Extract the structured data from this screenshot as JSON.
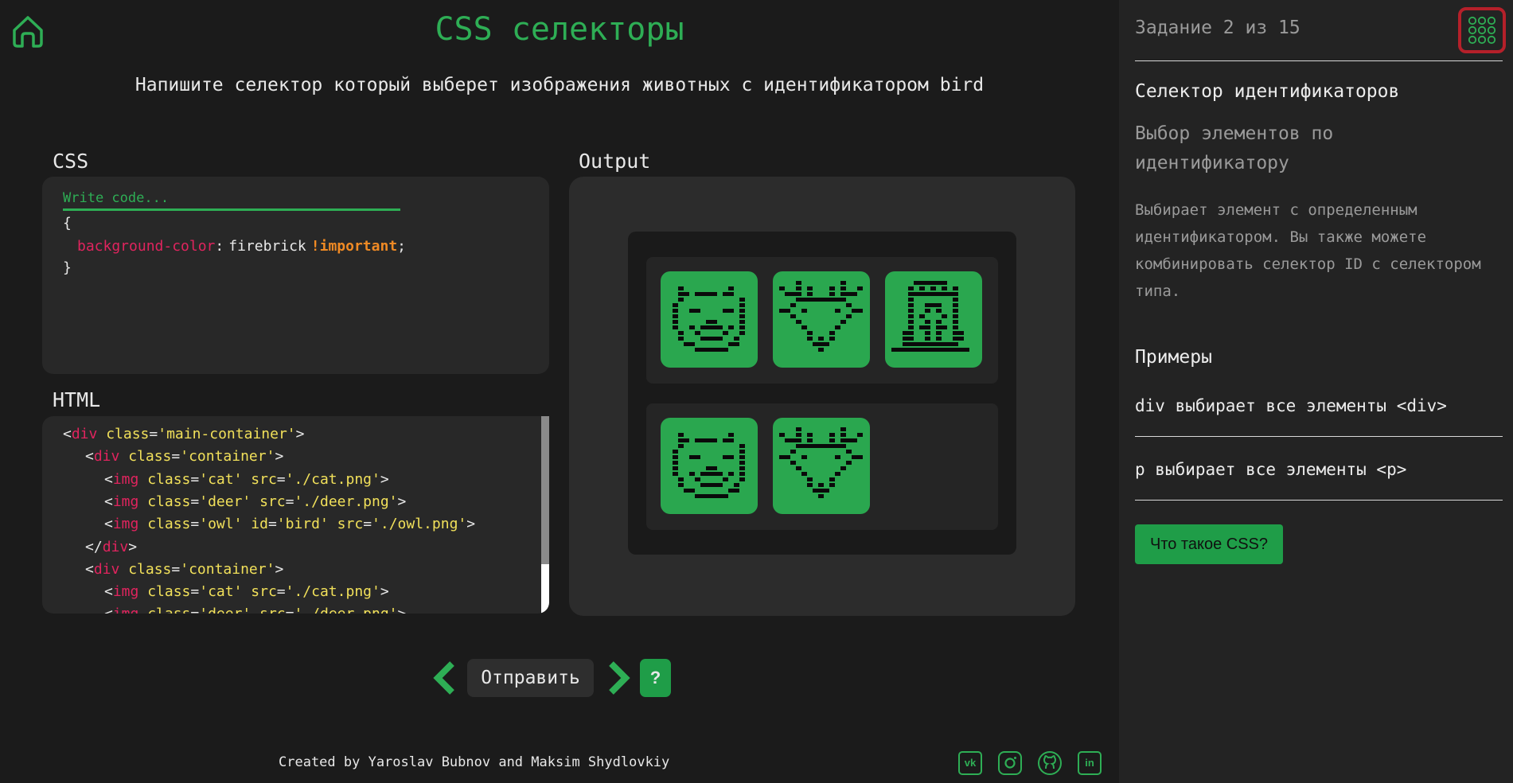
{
  "header": {
    "title": "CSS селекторы",
    "task": "Напишите селектор который выберет изображения животных с идентификатором bird"
  },
  "css_panel": {
    "label": "CSS",
    "placeholder": "Write code...",
    "open_brace": "{",
    "property": "background-color",
    "colon": ":",
    "value": "firebrick",
    "important": "!important",
    "semicolon": ";",
    "close_brace": "}"
  },
  "html_panel": {
    "label": "HTML",
    "lines": [
      {
        "indent": "",
        "open": "<",
        "tag": "div",
        "attrs": [
          {
            "name": "class",
            "value": "'main-container'"
          }
        ],
        "close": ">"
      },
      {
        "indent": "  ",
        "open": "<",
        "tag": "div",
        "attrs": [
          {
            "name": "class",
            "value": "'container'"
          }
        ],
        "close": ">"
      },
      {
        "indent": "    ",
        "open": "<",
        "tag": "img",
        "attrs": [
          {
            "name": "class",
            "value": "'cat'"
          },
          {
            "name": "src",
            "value": "'./cat.png'"
          }
        ],
        "close": ">"
      },
      {
        "indent": "    ",
        "open": "<",
        "tag": "img",
        "attrs": [
          {
            "name": "class",
            "value": "'deer'"
          },
          {
            "name": "src",
            "value": "'./deer.png'"
          }
        ],
        "close": ">"
      },
      {
        "indent": "    ",
        "open": "<",
        "tag": "img",
        "attrs": [
          {
            "name": "class",
            "value": "'owl'"
          },
          {
            "name": "id",
            "value": "'bird'"
          },
          {
            "name": "src",
            "value": "'./owl.png'"
          }
        ],
        "close": ">"
      },
      {
        "indent": "  ",
        "open": "</",
        "tag": "div",
        "attrs": [],
        "close": ">"
      },
      {
        "indent": "  ",
        "open": "<",
        "tag": "div",
        "attrs": [
          {
            "name": "class",
            "value": "'container'"
          }
        ],
        "close": ">"
      },
      {
        "indent": "    ",
        "open": "<",
        "tag": "img",
        "attrs": [
          {
            "name": "class",
            "value": "'cat'"
          },
          {
            "name": "src",
            "value": "'./cat.png'"
          }
        ],
        "close": ">"
      },
      {
        "indent": "    ",
        "open": "<",
        "tag": "img",
        "attrs": [
          {
            "name": "class",
            "value": "'deer'"
          },
          {
            "name": "src",
            "value": "'./deer.png'"
          }
        ],
        "close": ">"
      }
    ]
  },
  "output": {
    "label": "Output",
    "rows": [
      [
        "cat",
        "deer",
        "owl"
      ],
      [
        "cat",
        "deer"
      ]
    ]
  },
  "controls": {
    "submit_label": "Отправить",
    "help_label": "?",
    "prev_icon": "chevron-left-icon",
    "next_icon": "chevron-right-icon"
  },
  "footer": {
    "credits": "Created by Yaroslav Bubnov and Maksim Shydlovkiy",
    "social": [
      {
        "name": "vk-icon",
        "glyph": "vk"
      },
      {
        "name": "instagram-icon",
        "glyph": ""
      },
      {
        "name": "github-icon",
        "glyph": ""
      },
      {
        "name": "linkedin-icon",
        "glyph": "in"
      }
    ]
  },
  "sidebar": {
    "counter": "Задание 2 из 15",
    "selector_title": "Селектор идентификаторов",
    "selector_subtitle": "Выбор элементов по идентификатору",
    "description": "Выбирает элемент с определенным идентификатором. Вы также можете комбинировать селектор ID с селектором типа.",
    "examples_title": "Примеры",
    "examples": [
      "div выбирает все элементы <div>",
      "p выбирает все элементы <p>"
    ],
    "link_label": "Что такое CSS?"
  },
  "colors": {
    "accent": "#2eae55",
    "button_green": "#1f9d48",
    "tag_pink": "#e0245e",
    "attr_yellow": "#f1e05a",
    "important_orange": "#f08a24",
    "menu_border": "#b5202a"
  }
}
